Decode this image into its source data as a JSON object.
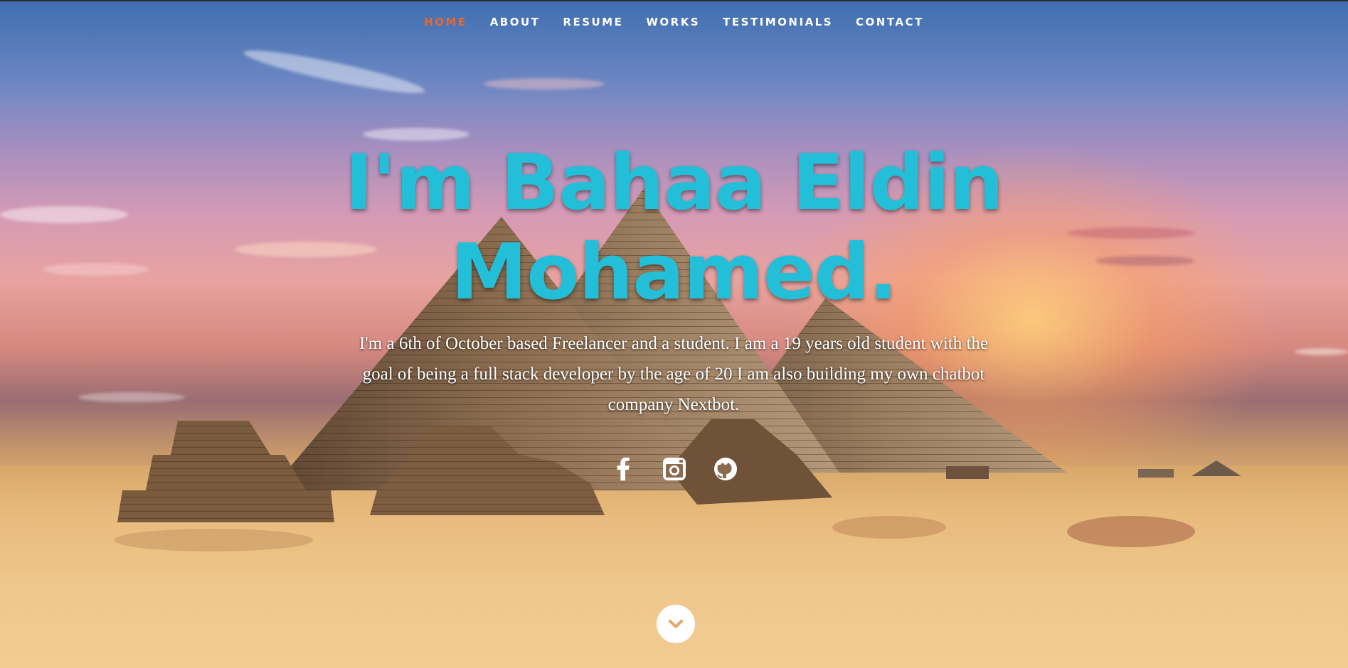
{
  "nav": {
    "items": [
      {
        "label": "HOME",
        "active": true
      },
      {
        "label": "ABOUT",
        "active": false
      },
      {
        "label": "RESUME",
        "active": false
      },
      {
        "label": "WORKS",
        "active": false
      },
      {
        "label": "TESTIMONIALS",
        "active": false
      },
      {
        "label": "CONTACT",
        "active": false
      }
    ],
    "active_color": "#e8692a"
  },
  "hero": {
    "headline_line1": "I'm Bahaa Eldin",
    "headline_line2": "Mohamed.",
    "headline_color": "#23bfd8",
    "intro": "I'm a 6th of October based Freelancer and a student. I am a 19 years old student with the goal of being a full stack developer by the age of 20 I am also building my own chatbot company Nextbot."
  },
  "social": {
    "icons": [
      "facebook-icon",
      "instagram-icon",
      "github-icon"
    ]
  },
  "scroll_button": {
    "icon": "chevron-down-icon"
  }
}
